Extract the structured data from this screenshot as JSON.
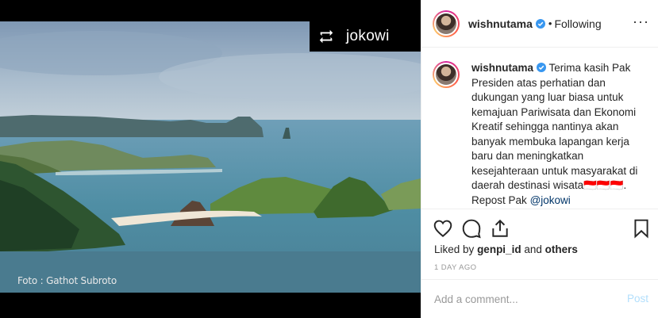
{
  "media": {
    "repost_username": "jokowi",
    "photo_credit": "Foto : Gathot Subroto"
  },
  "header": {
    "username": "wishnutama",
    "separator": "•",
    "follow_status": "Following",
    "more_icon": "more-dots-icon"
  },
  "caption": {
    "username": "wishnutama",
    "text": "Terima kasih Pak Presiden atas perhatian dan dukungan yang luar biasa untuk kemajuan Pariwisata dan Ekonomi Kreatif sehingga nantinya akan banyak membuka lapangan kerja baru dan meningkatkan kesejahteraan untuk masyarakat di daerah destinasi wisata🇮🇩🇮🇩🇮🇩.",
    "repost_prefix": "Repost Pak",
    "repost_mention": "@jokowi",
    "more_dots": "• • •"
  },
  "actions": {
    "like_icon": "heart-icon",
    "comment_icon": "comment-icon",
    "share_icon": "share-icon",
    "save_icon": "bookmark-icon"
  },
  "likes": {
    "prefix": "Liked by",
    "user": "genpi_id",
    "and": "and",
    "others": "others"
  },
  "timestamp": "1 DAY AGO",
  "comment": {
    "placeholder": "Add a comment...",
    "post_label": "Post"
  },
  "colors": {
    "verified_blue": "#3897f0",
    "post_disabled": "#b2dffc",
    "mention": "#003569"
  }
}
